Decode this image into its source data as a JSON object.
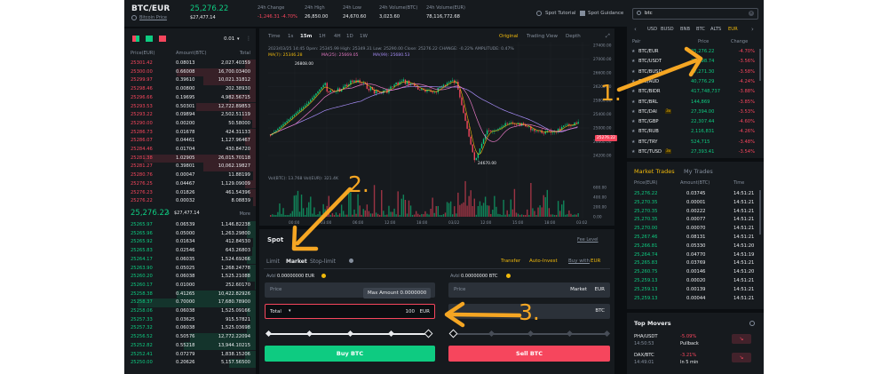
{
  "header": {
    "pair": "BTC/EUR",
    "pair_sub": "Bitcoin Price",
    "price": "25,276.22",
    "price_sub": "$27,477.14",
    "stats": [
      {
        "label": "24h Change",
        "value": "-1,246.31 -4.70%",
        "cls": "r"
      },
      {
        "label": "24h High",
        "value": "26,850.00",
        "cls": "w"
      },
      {
        "label": "24h Low",
        "value": "24,670.60",
        "cls": "w"
      },
      {
        "label": "24h Volume(BTC)",
        "value": "3,023.60",
        "cls": "w"
      },
      {
        "label": "24h Volume(EUR)",
        "value": "78,116,772.68",
        "cls": "w"
      }
    ],
    "spot_tutorial": "Spot Tutorial",
    "spot_guidance": "Spot Guidance"
  },
  "orderbook": {
    "precision": "0.01",
    "headers": [
      "Price(EUR)",
      "Amount(BTC)",
      "Total"
    ],
    "asks": [
      [
        "25301.42",
        "0.08013",
        "2,027.40359"
      ],
      [
        "25300.00",
        "0.66008",
        "16,700.03400"
      ],
      [
        "25299.97",
        "0.39610",
        "10,021.31812"
      ],
      [
        "25298.46",
        "0.00800",
        "202.38930"
      ],
      [
        "25296.66",
        "0.19695",
        "4,982.56715"
      ],
      [
        "25293.53",
        "0.50301",
        "12,722.89853"
      ],
      [
        "25293.22",
        "0.09894",
        "2,502.51119"
      ],
      [
        "25290.00",
        "0.00200",
        "50.58000"
      ],
      [
        "25286.73",
        "0.01678",
        "424.31133"
      ],
      [
        "25286.07",
        "0.04461",
        "1,127.96467"
      ],
      [
        "25284.46",
        "0.01704",
        "430.84720"
      ],
      [
        "25281.38",
        "1.02905",
        "26,015.70118"
      ],
      [
        "25281.27",
        "0.39801",
        "10,062.19827"
      ],
      [
        "25280.76",
        "0.00047",
        "11.88199"
      ],
      [
        "25276.25",
        "0.04467",
        "1,129.09009"
      ],
      [
        "25276.23",
        "0.01826",
        "461.54396"
      ],
      [
        "25276.22",
        "0.00032",
        "8.08839"
      ]
    ],
    "asks_depth": [
      0.08,
      0.6,
      0.4,
      0.05,
      0.2,
      0.45,
      0.1,
      0.03,
      0.05,
      0.08,
      0.05,
      0.85,
      0.4,
      0.02,
      0.08,
      0.05,
      0.02
    ],
    "mid_price": "25,276.22",
    "mid_usd": "$27,477.14",
    "mid_more": "More",
    "bids": [
      [
        "25265.97",
        "0.06539",
        "1,146.82238"
      ],
      [
        "25265.96",
        "0.05000",
        "1,263.29800"
      ],
      [
        "25265.92",
        "0.01634",
        "412.84530"
      ],
      [
        "25265.83",
        "0.02546",
        "643.26803"
      ],
      [
        "25264.17",
        "0.06035",
        "1,524.69266"
      ],
      [
        "25263.90",
        "0.05025",
        "1,268.24778"
      ],
      [
        "25260.20",
        "0.06038",
        "1,525.21088"
      ],
      [
        "25260.17",
        "0.01000",
        "252.60170"
      ],
      [
        "25258.38",
        "0.41265",
        "10,422.82926"
      ],
      [
        "25258.37",
        "0.70000",
        "17,680.78900"
      ],
      [
        "25258.06",
        "0.06038",
        "1,525.09166"
      ],
      [
        "25257.33",
        "0.03625",
        "915.57821"
      ],
      [
        "25257.32",
        "0.06038",
        "1,525.03698"
      ],
      [
        "25256.52",
        "0.50576",
        "12,772.22094"
      ],
      [
        "25252.82",
        "0.55218",
        "13,944.10215"
      ],
      [
        "25252.41",
        "0.07279",
        "1,838.15206"
      ],
      [
        "25250.00",
        "0.20626",
        "5,157.56500"
      ]
    ],
    "bids_depth": [
      0.06,
      0.07,
      0.02,
      0.03,
      0.07,
      0.05,
      0.07,
      0.01,
      0.6,
      0.9,
      0.07,
      0.04,
      0.07,
      0.5,
      0.55,
      0.08,
      0.2
    ]
  },
  "chart": {
    "tabs": [
      "Time",
      "1s",
      "15m",
      "1H",
      "4H",
      "1D",
      "1W"
    ],
    "active_tab": "15m",
    "views": [
      "Original",
      "Trading View",
      "Depth"
    ],
    "active_view": "Original",
    "info": "2023/03/25 14:45 Open: 25345.99 High: 25349.31 Low: 25290.00 Close: 25276.22 CHANGE: -0.22% AMPLITUDE: 0.47%",
    "ma": [
      {
        "t": "MA(7): 25346.28",
        "c": "#f0b90b"
      },
      {
        "t": "MA(25): 25669.05",
        "c": "#e377c2"
      },
      {
        "t": "MA(99): 25680.53",
        "c": "#a58bf5"
      }
    ],
    "high_label": "26808.00",
    "low_label": "24670.00",
    "current": "25276.22",
    "y_ticks": [
      "27400.00",
      "27000.00",
      "26600.00",
      "26200.00",
      "25800.00",
      "25400.00",
      "25000.00",
      "24600.00",
      "24200.00"
    ],
    "vol_label": "Vol(BTC): 13.768 Vol(EUR): 321.4K",
    "vol_ticks": [
      "600.00",
      "400.00",
      "200.00",
      "0.00"
    ],
    "x_ticks": [
      "00:00",
      "03:00",
      "06:00",
      "12:00",
      "18:00",
      "03/22",
      "12:00",
      "15:00",
      "18:00",
      "03:02"
    ]
  },
  "order": {
    "title": "Spot",
    "fee_level": "Fee Level",
    "types": [
      "Limit",
      "Market",
      "Stop-limit"
    ],
    "active_type": "Market",
    "transfer": "Transfer",
    "auto_invest": "Auto-Invest",
    "buy_with": "Buy with",
    "buy_ccy": "EUR",
    "buy_avbl": "Avbl",
    "buy_avbl_val": "0.00000000 EUR",
    "sell_avbl": "Avbl",
    "sell_avbl_val": "0.00000000 BTC",
    "price_label": "Price",
    "market_label": "Market",
    "eur": "EUR",
    "tooltip": "Max Amount 0.0000000",
    "total_label": "Total",
    "total_value": "100",
    "sell_btc": "BTC",
    "buy_btn": "Buy BTC",
    "sell_btn": "Sell BTC"
  },
  "markets": {
    "search": "btc",
    "filters": [
      "USD",
      "BUSD",
      "BNB",
      "BTC",
      "ALTS",
      "EUR"
    ],
    "active_filter": "EUR",
    "headers": [
      "Pair",
      "Price",
      "Change"
    ],
    "rows": [
      [
        "BTC/EUR",
        "25,276.22",
        "-4.70%"
      ],
      [
        "BTC/USDT",
        "27,398.74",
        "-3.56%"
      ],
      [
        "BTC/BUSD",
        "27,271.30",
        "-3.58%"
      ],
      [
        "BTC/AUD",
        "40,776.29",
        "-4.24%"
      ],
      [
        "BTC/BIDR",
        "417,748,737",
        "-3.88%"
      ],
      [
        "BTC/BRL",
        "144,869",
        "-3.85%"
      ],
      [
        "BTC/DAI",
        "27,394.00",
        "-3.53%"
      ],
      [
        "BTC/GBP",
        "22,307.44",
        "-4.60%"
      ],
      [
        "BTC/RUB",
        "2,116,831",
        "-4.26%"
      ],
      [
        "BTC/TRY",
        "524,715",
        "-3.48%"
      ],
      [
        "BTC/TUSD",
        "27,393.41",
        "-3.54%"
      ]
    ],
    "badges": {
      "6": "3x",
      "10": "3x"
    }
  },
  "trades": {
    "tabs": [
      "Market Trades",
      "My Trades"
    ],
    "headers": [
      "Price(EUR)",
      "Amount(BTC)",
      "Time"
    ],
    "rows": [
      [
        "25,276.22",
        "0.03745",
        "14:51:21"
      ],
      [
        "25,270.35",
        "0.00001",
        "14:51:21"
      ],
      [
        "25,270.35",
        "0.00222",
        "14:51:21"
      ],
      [
        "25,270.35",
        "0.00077",
        "14:51:21"
      ],
      [
        "25,270.00",
        "0.00070",
        "14:51:21"
      ],
      [
        "25,267.46",
        "0.08131",
        "14:51:21"
      ],
      [
        "25,266.81",
        "0.05330",
        "14:51:20"
      ],
      [
        "25,264.74",
        "0.04770",
        "14:51:19"
      ],
      [
        "25,265.83",
        "0.03769",
        "14:51:21"
      ],
      [
        "25,260.75",
        "0.00146",
        "14:51:20"
      ],
      [
        "25,259.13",
        "0.00020",
        "14:51:21"
      ],
      [
        "25,259.13",
        "0.00139",
        "14:51:21"
      ],
      [
        "25,259.13",
        "0.00044",
        "14:51:21"
      ]
    ]
  },
  "movers": {
    "title": "Top Movers",
    "items": [
      {
        "pair": "PHA/USDT",
        "time": "14:50:53",
        "change": "-5.09%",
        "desc": "Pullback"
      },
      {
        "pair": "DAX/BTC",
        "time": "14:49:01",
        "change": "-3.21%",
        "desc": "In 5 min"
      }
    ]
  },
  "annotations": [
    "1.",
    "2.",
    "3."
  ],
  "colors": {
    "green": "#0ecb81",
    "red": "#f6465d",
    "accent": "#f0b90b",
    "arrow": "#f5a623"
  }
}
